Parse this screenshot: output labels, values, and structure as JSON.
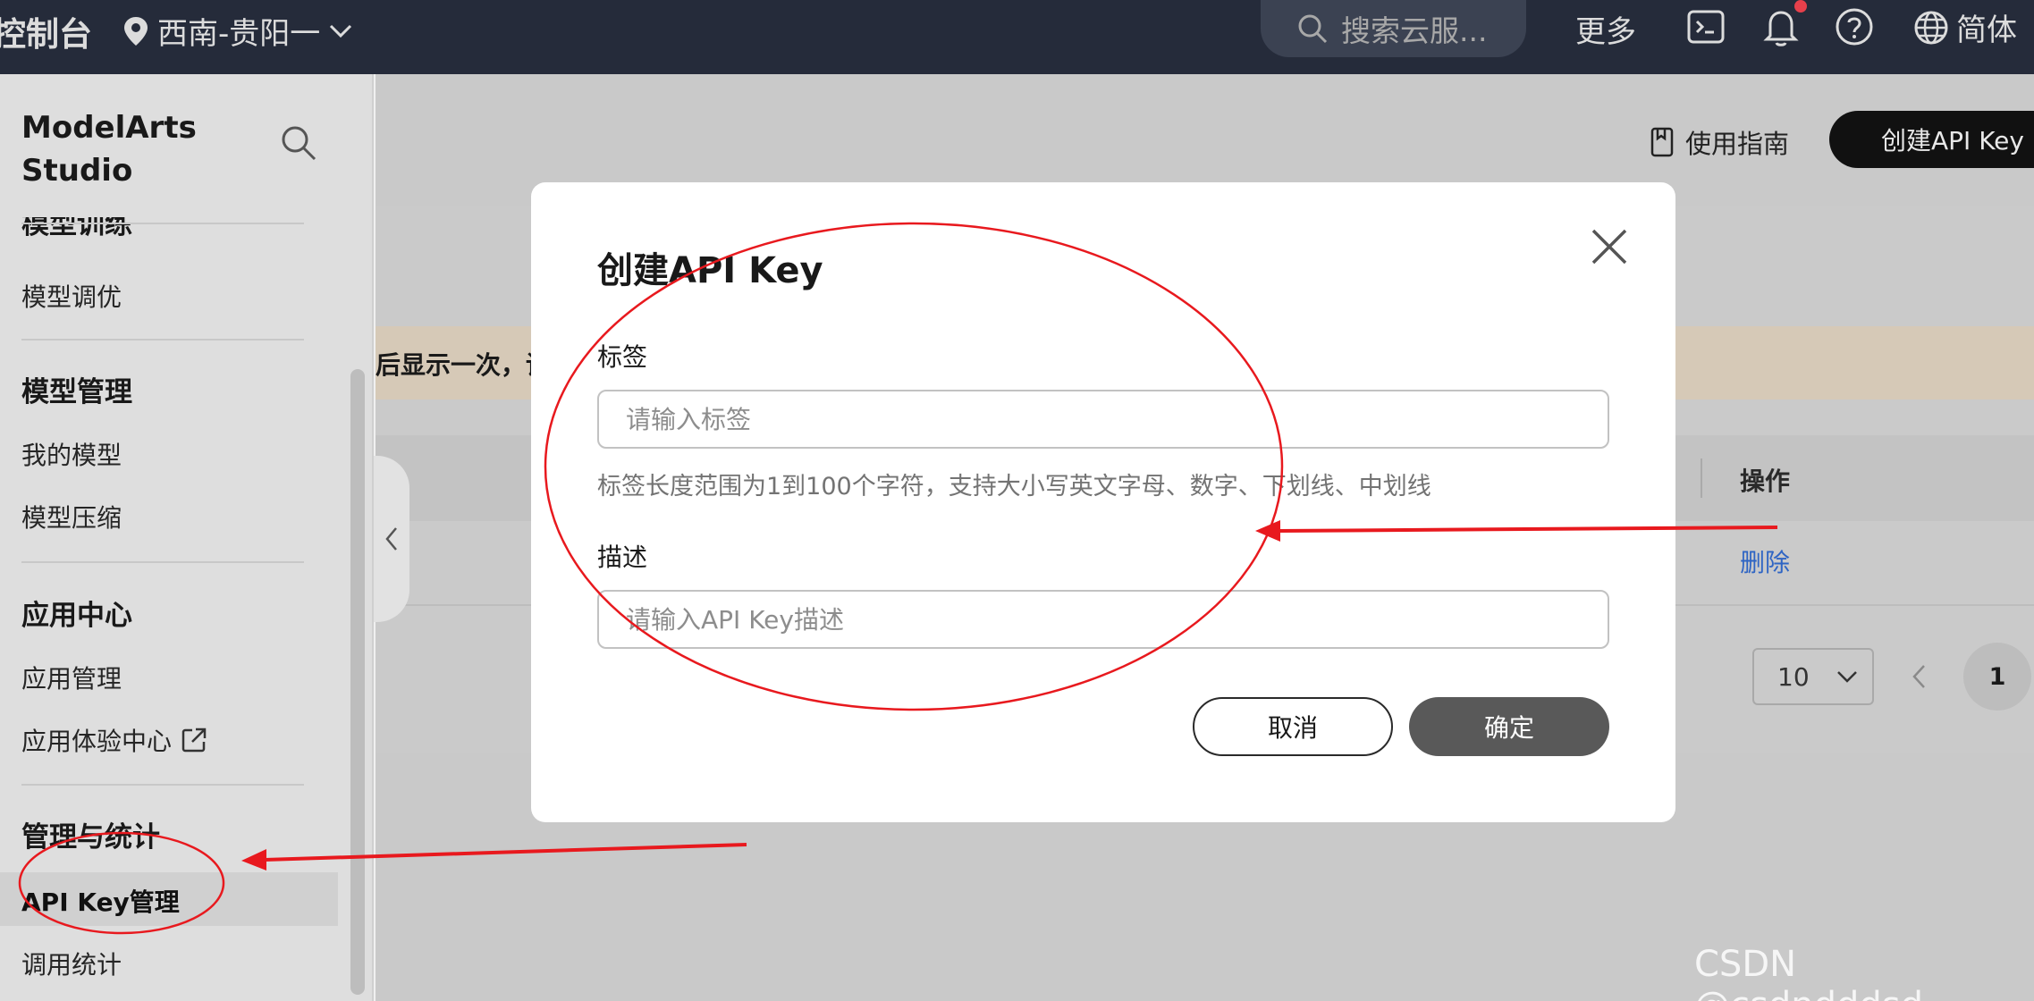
{
  "topbar": {
    "brand": "控制台",
    "region": "西南-贵阳一",
    "search_placeholder": "搜索云服...",
    "more": "更多",
    "language": "简体"
  },
  "sidebar": {
    "title": "ModelArts Studio",
    "partial_group": "模型训练",
    "items": {
      "model_tuning": "模型调优",
      "my_models": "我的模型",
      "model_compress": "模型压缩",
      "app_manage": "应用管理",
      "app_experience": "应用体验中心",
      "api_key_manage": "API Key管理",
      "call_stats": "调用统计"
    },
    "groups": {
      "model_manage": "模型管理",
      "app_center": "应用中心",
      "manage_stats": "管理与统计"
    }
  },
  "main": {
    "guide": "使用指南",
    "create_button": "创建API Key",
    "notice_partial": "后显示一次，请",
    "table": {
      "op_header": "操作",
      "delete_link": "删除"
    },
    "pager": {
      "page_size": "10",
      "current_page": "1"
    }
  },
  "modal": {
    "title": "创建API Key",
    "tag_label": "标签",
    "tag_placeholder": "请输入标签",
    "tag_hint": "标签长度范围为1到100个字符，支持大小写英文字母、数字、下划线、中划线",
    "desc_label": "描述",
    "desc_placeholder": "请输入API Key描述",
    "cancel": "取消",
    "confirm": "确定"
  },
  "watermark": "CSDN @csdndddsd",
  "colors": {
    "topbar_bg": "#252b3a",
    "annotation_red": "#e8191e",
    "link_blue": "#2f65c4"
  }
}
